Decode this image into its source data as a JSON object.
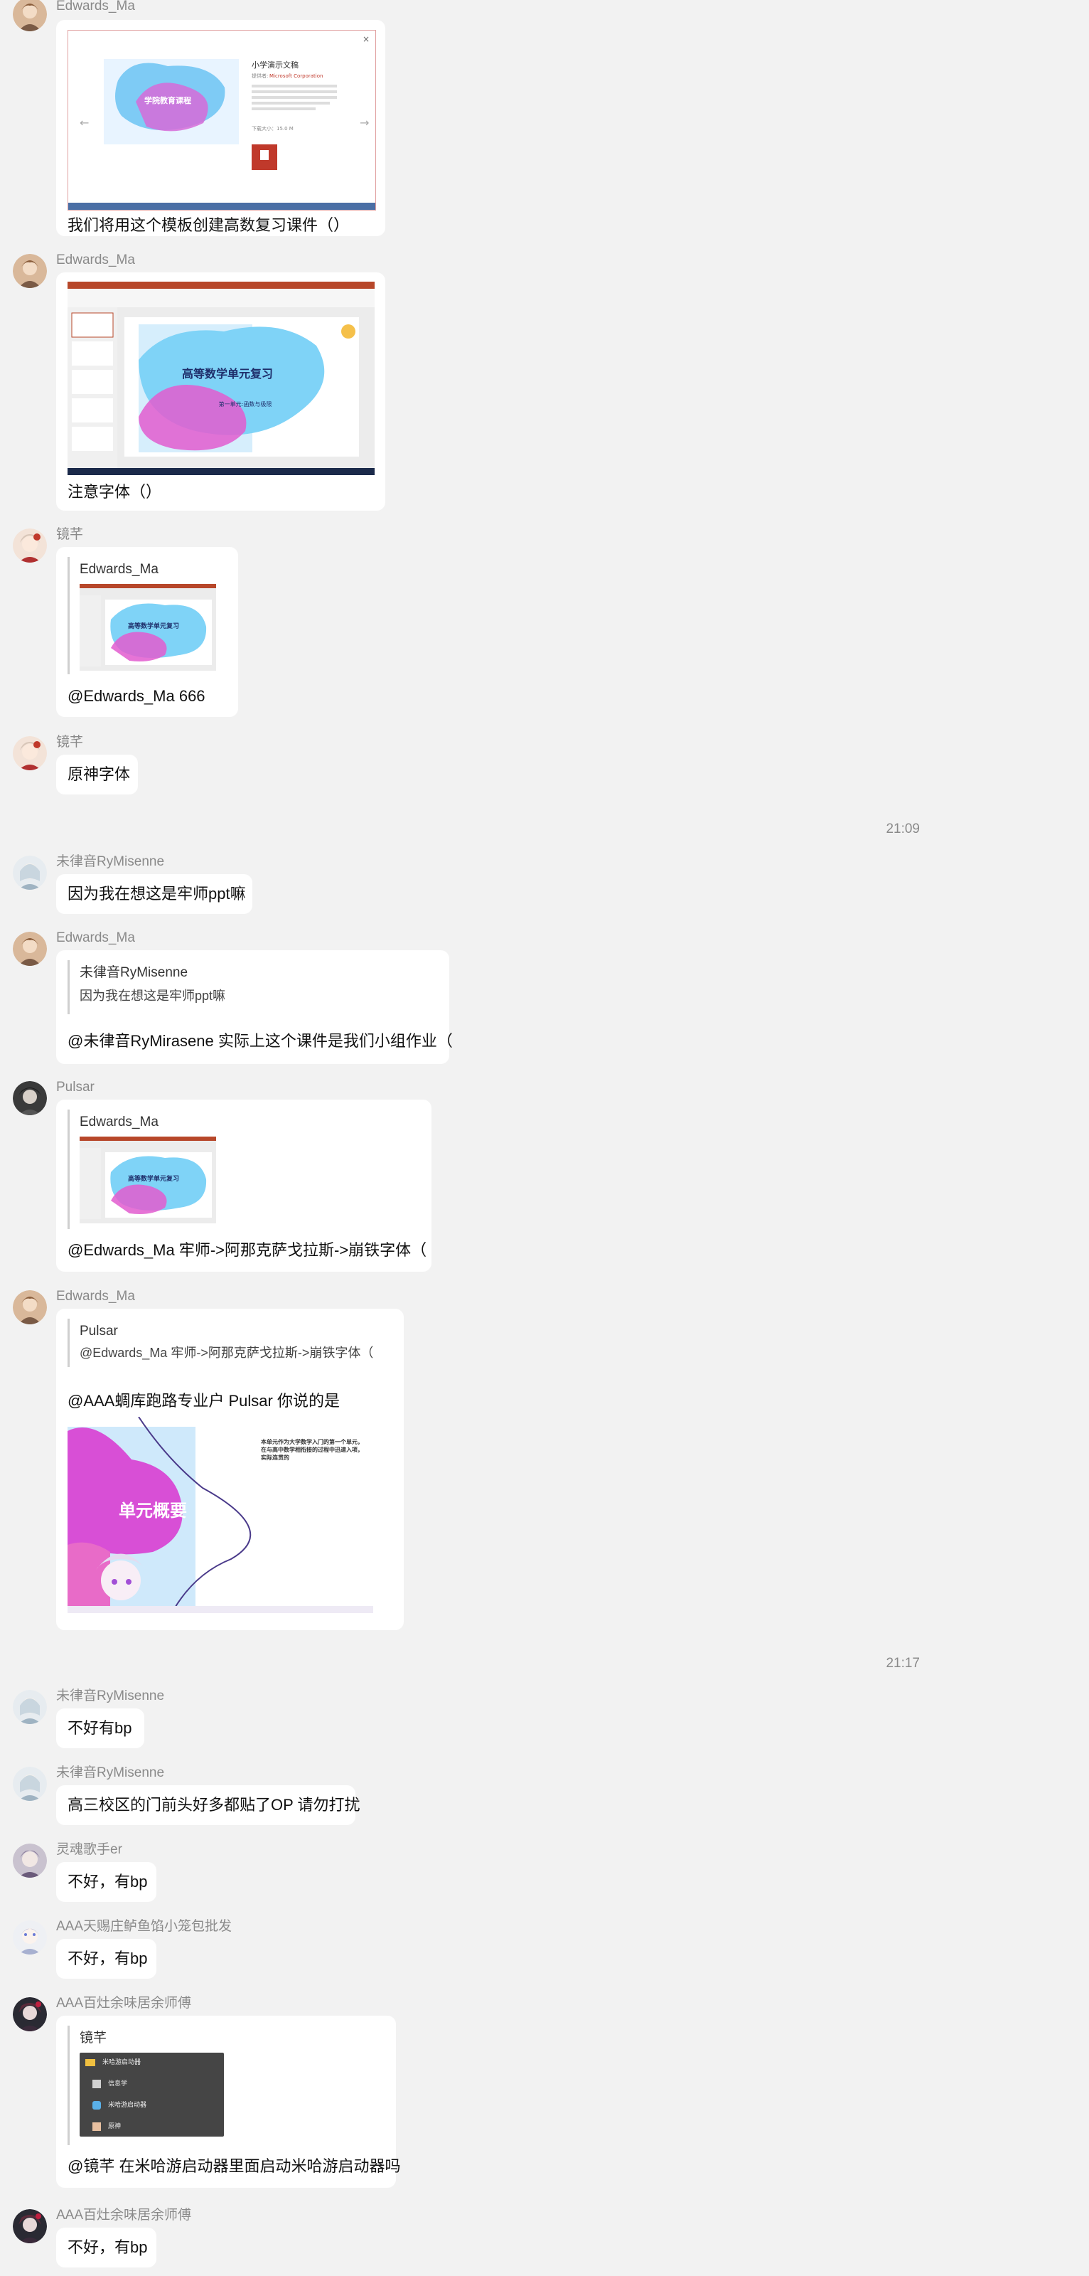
{
  "messages": [
    {
      "sender": "Edwards_Ma",
      "text": "我们将用这个模板创建高数复习课件（）",
      "preview": {
        "title": "小学演示文稿",
        "brand": "Microsoft Corporation",
        "cover": "学院教育课程",
        "size": "下载大小：15.0 M"
      }
    },
    {
      "sender": "Edwards_Ma",
      "text": "注意字体（）",
      "slide": {
        "title": "高等数学单元复习",
        "subtitle": "第一单元:函数与极限"
      }
    },
    {
      "sender": "镜芊",
      "quote_name": "Edwards_Ma",
      "text": "@Edwards_Ma 666",
      "slide": {
        "title": "高等数学单元复习"
      }
    },
    {
      "sender": "镜芊",
      "text": "原神字体"
    },
    {
      "sender": "未律音RyMisenne",
      "text": "因为我在想这是牢师ppt嘛"
    },
    {
      "sender": "Edwards_Ma",
      "quote_name": "未律音RyMisenne",
      "quote_text": "因为我在想这是牢师ppt嘛",
      "text": "@未律音RyMirasene 实际上这个课件是我们小组作业（"
    },
    {
      "sender": "Pulsar",
      "quote_name": "Edwards_Ma",
      "text": "@Edwards_Ma 牢师->阿那克萨戈拉斯->崩铁字体（",
      "slide": {
        "title": "高等数学单元复习"
      }
    },
    {
      "sender": "Edwards_Ma",
      "quote_name": "Pulsar",
      "quote_text": "@Edwards_Ma 牢师->阿那克萨戈拉斯->崩铁字体（",
      "text": "@AAA蜩库跑路专业户 Pulsar 你说的是",
      "slide": {
        "title": "单元概要",
        "body": "本单元作为大学数学入门的第一个单元，在与高中数学相衔接的过程中迅速入项，实际连贯的"
      }
    },
    {
      "sender": "未律音RyMisenne",
      "text": "不好有bp"
    },
    {
      "sender": "未律音RyMisenne",
      "text": "高三校区的门前头好多都贴了OP 请勿打扰"
    },
    {
      "sender": "灵魂歌手er",
      "text": "不好，有bp"
    },
    {
      "sender": "AAA天赐庄鲈鱼馅小笼包批发",
      "text": "不好，有bp"
    },
    {
      "sender": "AAA百灶余味居余师傅",
      "quote_name": "镜芊",
      "text": "@镜芊 在米哈游启动器里面启动米哈游启动器吗",
      "files": [
        "米哈游启动器",
        "信息学",
        "米哈游启动器",
        "原神"
      ]
    },
    {
      "sender": "AAA百灶余味居余师傅",
      "text": "不好，有bp"
    }
  ],
  "timestamps": [
    "21:09",
    "21:17"
  ],
  "colors": {
    "accent": "#e83a7a",
    "background": "#f2f2f2",
    "bubble": "#ffffff"
  }
}
